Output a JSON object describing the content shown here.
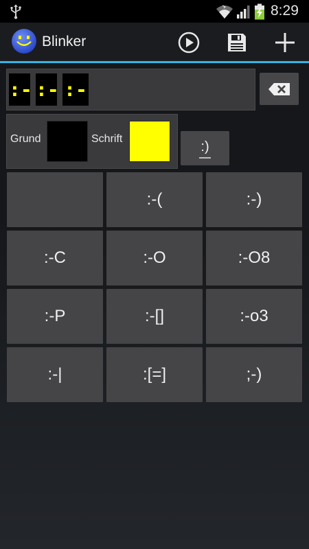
{
  "status_bar": {
    "time": "8:29",
    "icons": [
      "usb-icon",
      "wifi-icon",
      "signal-icon",
      "battery-charging-icon"
    ]
  },
  "action_bar": {
    "title": "Blinker",
    "app_icon": "smiley-app-icon",
    "actions": [
      {
        "name": "play",
        "icon": "play-icon"
      },
      {
        "name": "save",
        "icon": "save-icon"
      },
      {
        "name": "add",
        "icon": "plus-icon"
      }
    ]
  },
  "preview": {
    "cells": [
      ":-|",
      ":-|",
      ":-P"
    ],
    "text_color": "#ffff00",
    "background_color": "#000000"
  },
  "colors": {
    "background_label": "Grund",
    "background_value": "#000000",
    "text_label": "Schrift",
    "text_value": "#ffff00"
  },
  "emoticon_toggle": ":)",
  "grid_buttons": [
    "",
    ":-(",
    ":-)",
    ":-C",
    ":-O",
    ":-O8",
    ":-P",
    ":-[]",
    ":-o3",
    ":-|",
    ":[=]",
    ";-)"
  ],
  "theme": {
    "accent": "#33b5e5",
    "button_bg": "#454547",
    "panel_bg": "#3a3a3c"
  }
}
